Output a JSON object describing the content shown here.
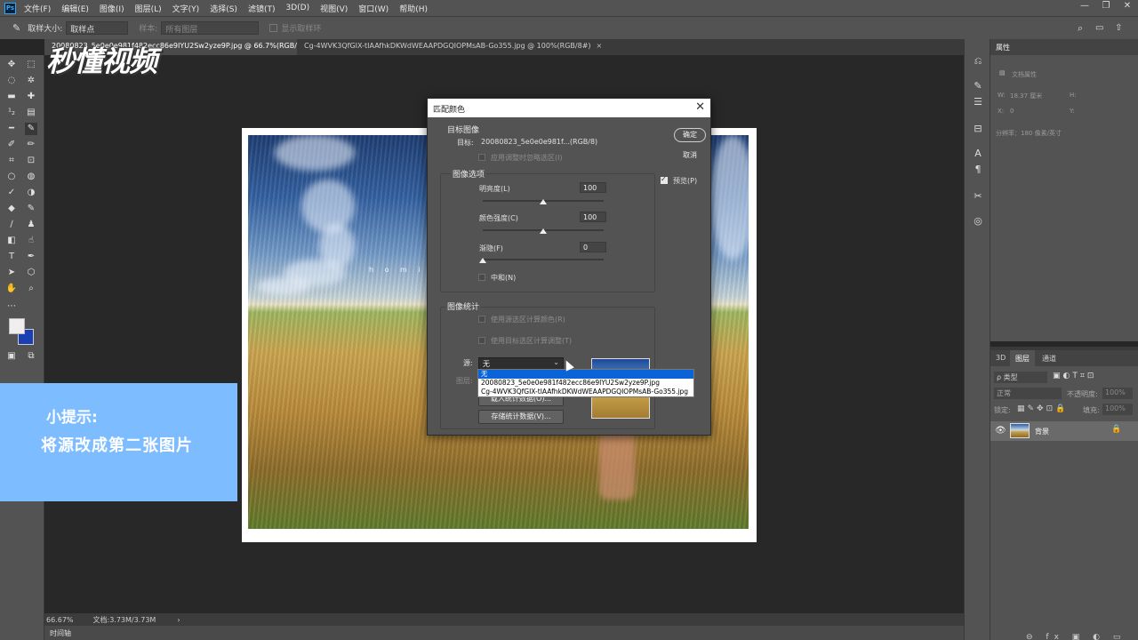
{
  "menu": {
    "logo": "Ps",
    "items": [
      "文件(F)",
      "编辑(E)",
      "图像(I)",
      "图层(L)",
      "文字(Y)",
      "选择(S)",
      "滤镜(T)",
      "3D(D)",
      "视图(V)",
      "窗口(W)",
      "帮助(H)"
    ],
    "window_controls": [
      "—",
      "❐",
      "✕"
    ]
  },
  "options": {
    "sample_size_label": "取样大小:",
    "sample_size_value": "取样点",
    "sample_label": "样本:",
    "sample_value": "所有图层",
    "show_ring_label": "显示取样环"
  },
  "tabs": [
    {
      "label": "20080823_5e0e0e981f482ecc86e9IYU2Sw2yze9P.jpg @ 66.7%(RGB/8) *",
      "close": "×"
    },
    {
      "label": "Cg-4WVK3QfGIX-tIAAfhkDKWdWEAAPDGQIOPMsAB-Go355.jpg @ 100%(RGB/8#)",
      "close": "×"
    }
  ],
  "watermark": "秒懂视频",
  "photo_caption": "h o m i t u",
  "status": {
    "zoom": "66.67%",
    "doc": "文档:3.73M/3.73M",
    "arrow": "›",
    "timeline": "时间轴"
  },
  "tip": {
    "title": "小提示:",
    "body": "将源改成第二张图片"
  },
  "dialog": {
    "title": "匹配颜色",
    "close": "✕",
    "target_group": "目标图像",
    "target_label": "目标:",
    "target_value": "20080823_5e0e0e981f...(RGB/8)",
    "apply_selection": "应用调整时忽略选区(I)",
    "options_group": "图像选项",
    "luminance_label": "明亮度(L)",
    "luminance_value": "100",
    "luminance_level": 100,
    "intensity_label": "颜色强度(C)",
    "intensity_value": "100",
    "intensity_level": 100,
    "fade_label": "渐隐(F)",
    "fade_value": "0",
    "fade_level": 0,
    "neutralize_label": "中和(N)",
    "stats_group": "图像统计",
    "use_source_sel": "使用源选区计算颜色(R)",
    "use_target_sel": "使用目标选区计算调整(T)",
    "source_label": "源:",
    "source_value": "无",
    "layer_label": "图层:",
    "load_stats": "载入统计数据(O)...",
    "save_stats": "存储统计数据(V)...",
    "ok": "确定",
    "cancel": "取消",
    "preview": "预览(P)",
    "dropdown_options": [
      "无",
      "20080823_5e0e0e981f482ecc86e9IYU2Sw2yze9P.jpg",
      "Cg-4WVK3QfGIX-tIAAfhkDKWdWEAAPDGQIOPMsAB-Go355.jpg"
    ]
  },
  "properties": {
    "title": "属性",
    "doc_props": "文档属性",
    "w_label": "W:",
    "w_value": "18.37 厘米",
    "h_label": "H:",
    "x_label": "X:",
    "x_value": "0",
    "y_label": "Y:",
    "resolution": "分辨率：180 像素/英寸"
  },
  "layers": {
    "tabs": [
      "3D",
      "图层",
      "通道"
    ],
    "kind": "ρ 类型",
    "blend": "正常",
    "opacity_label": "不透明度:",
    "opacity": "100%",
    "lock_label": "锁定:",
    "fill_label": "填充:",
    "fill": "100%",
    "layer_name": "背景"
  }
}
